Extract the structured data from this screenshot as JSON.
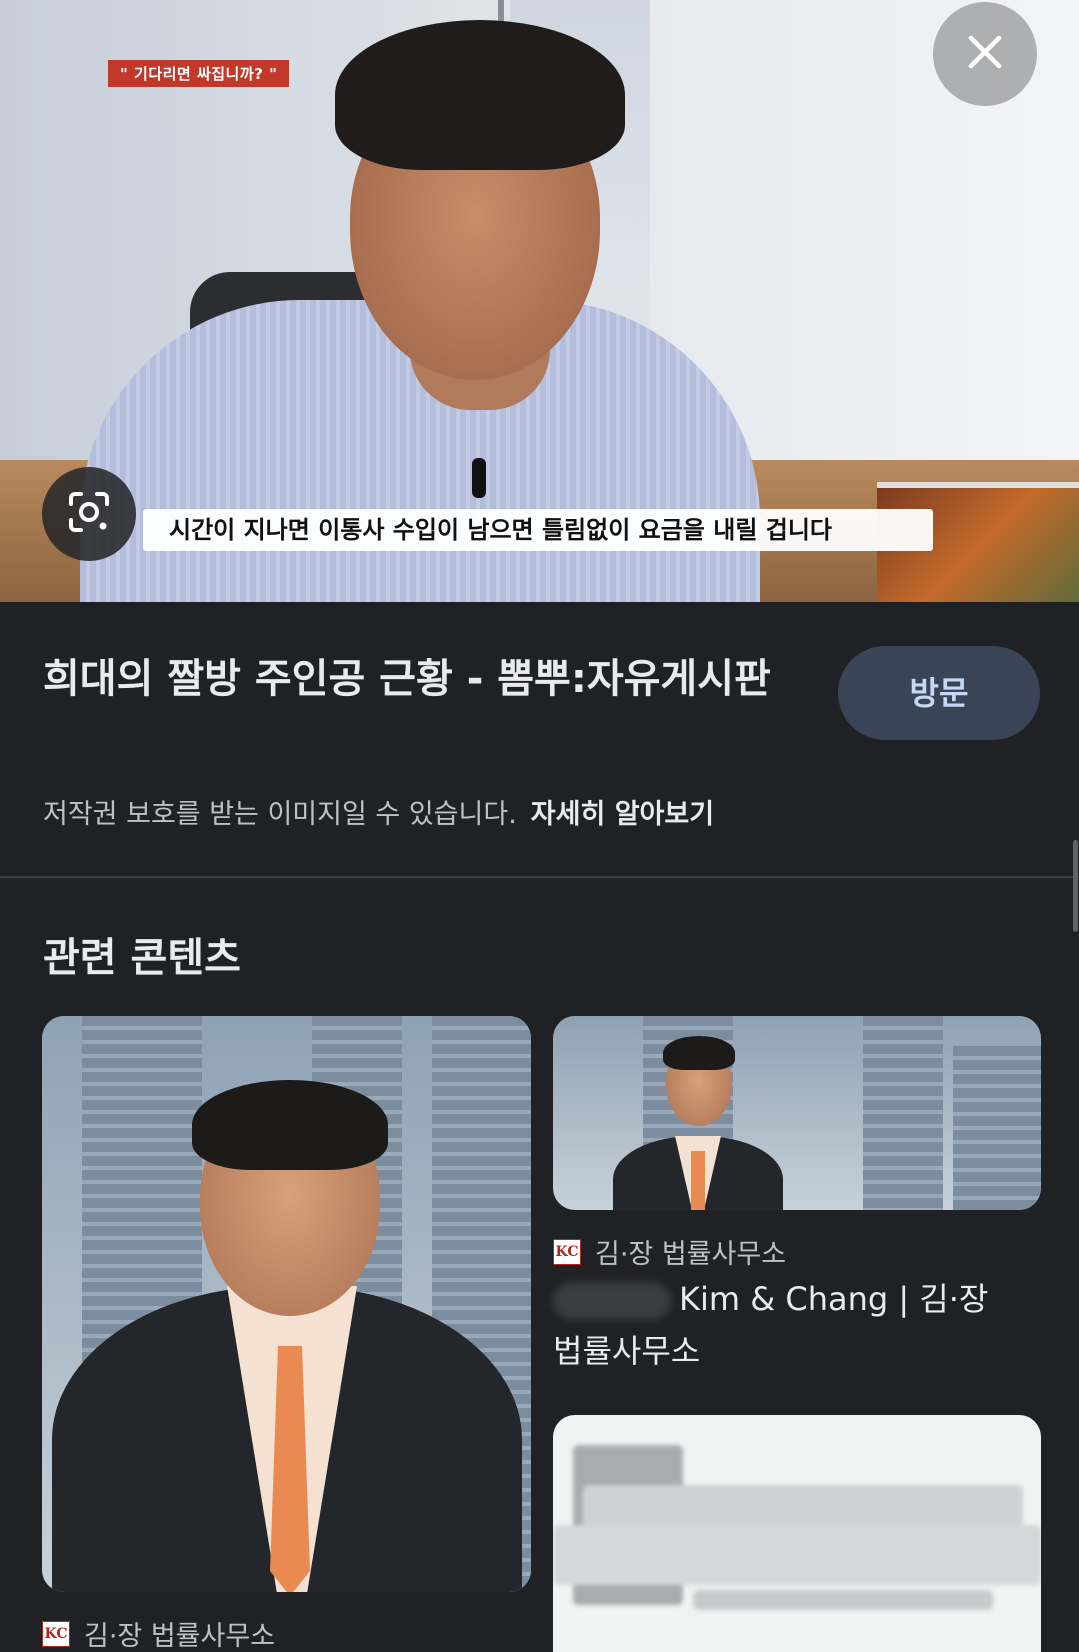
{
  "hero": {
    "overlay_top_label": "\" 기다리면 싸집니까? \"",
    "overlay_subtitle": "시간이 지나면 이통사 수입이 남으면 틀림없이 요금을 내릴 겁니다"
  },
  "icons": {
    "lens": "google-lens-icon",
    "close": "close-icon"
  },
  "result": {
    "title": "희대의 짤방 주인공 근황 - 뽐뿌:자유게시판",
    "visit_button": "방문",
    "copyright_notice": "저작권 보호를 받는 이미지일 수 있습니다.",
    "learn_more": "자세히 알아보기"
  },
  "related": {
    "heading": "관련 콘텐츠",
    "cards": [
      {
        "source": "김·장 법률사무소",
        "logo_text": "KC"
      },
      {
        "source": "김·장 법률사무소",
        "logo_text": "KC",
        "title": "Kim & Chang | 김·장 법률사무소"
      }
    ]
  },
  "colors": {
    "background": "#202124",
    "visit_button_bg": "#394457",
    "visit_button_text": "#c5d9f7"
  }
}
